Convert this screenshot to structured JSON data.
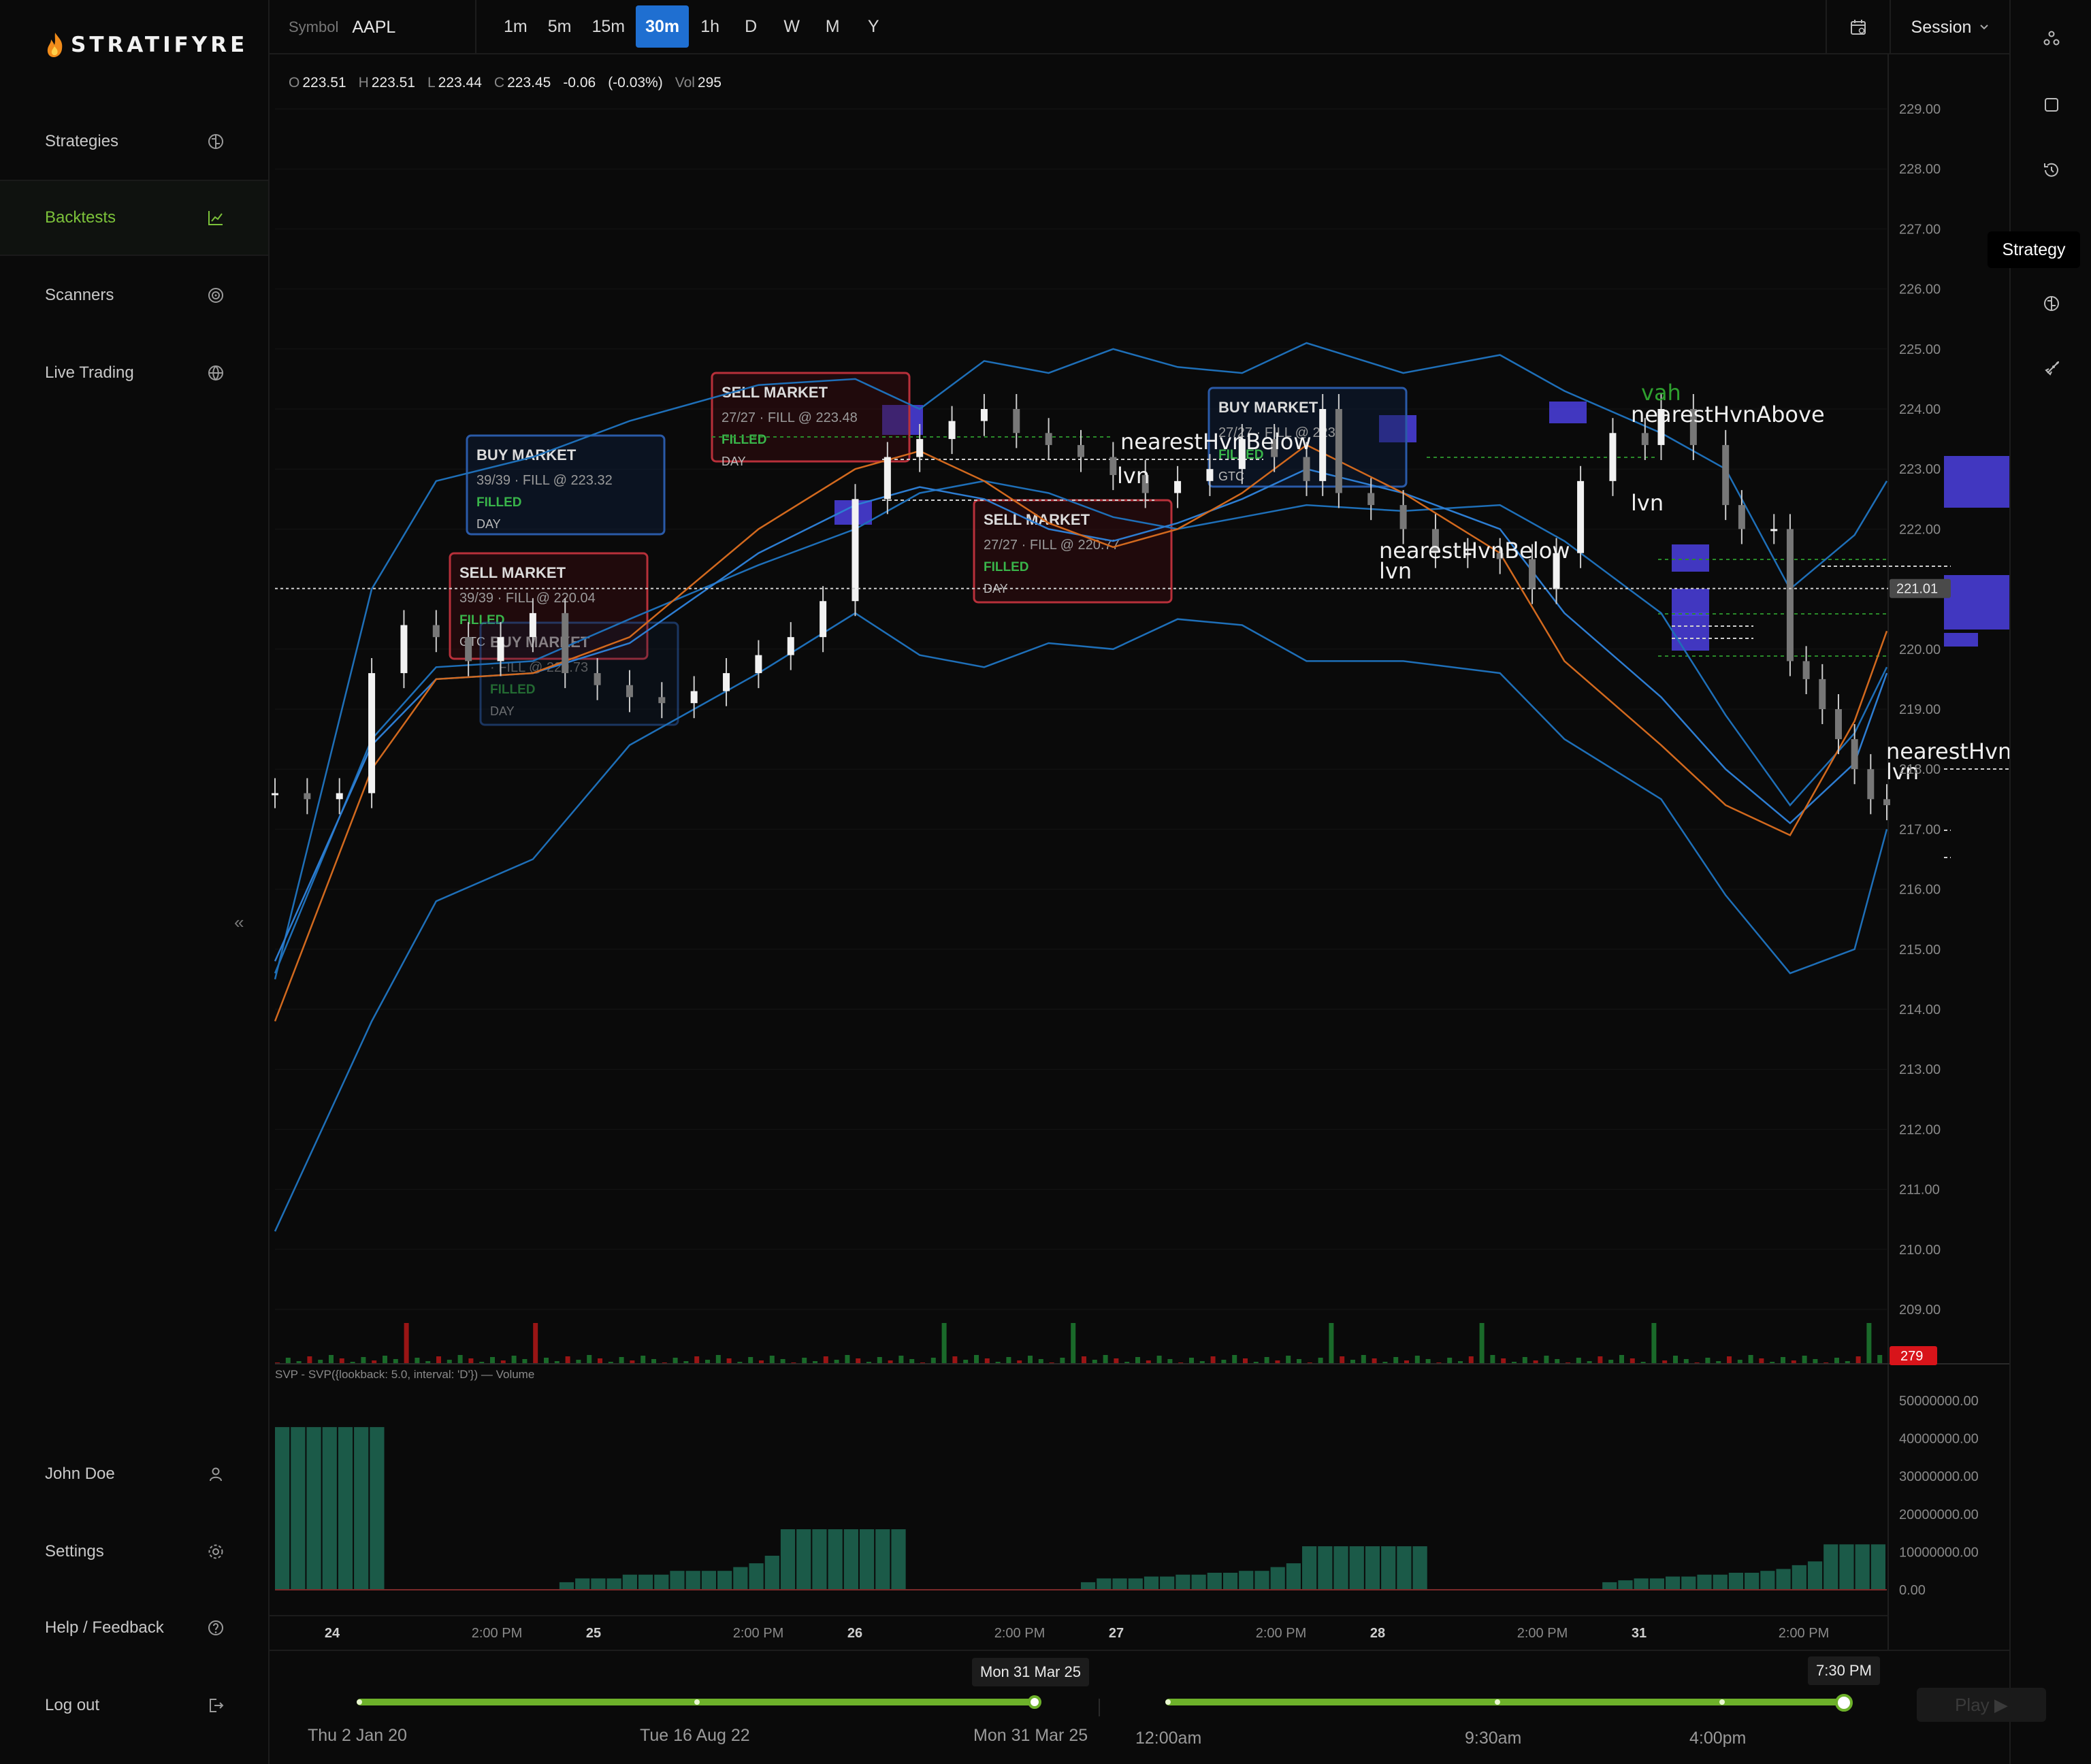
{
  "sidebar": {
    "logo_text": "STRATIFYRE",
    "nav": [
      {
        "label": "Strategies",
        "icon": "brain-icon",
        "active": false
      },
      {
        "label": "Backtests",
        "icon": "chart-bars-icon",
        "active": true
      },
      {
        "label": "Scanners",
        "icon": "radar-icon",
        "active": false
      },
      {
        "label": "Live Trading",
        "icon": "globe-icon",
        "active": false
      }
    ],
    "bottom": [
      {
        "label": "John Doe",
        "icon": "user-icon"
      },
      {
        "label": "Settings",
        "icon": "gear-icon"
      },
      {
        "label": "Help / Feedback",
        "icon": "help-icon"
      },
      {
        "label": "Log out",
        "icon": "logout-icon"
      }
    ],
    "collapse_glyph": "«"
  },
  "topbar": {
    "symbol_label": "Symbol",
    "symbol_value": "AAPL",
    "intervals": [
      "1m",
      "5m",
      "15m",
      "30m",
      "1h",
      "D",
      "W",
      "M",
      "Y"
    ],
    "active_interval": "30m",
    "session_label": "Session"
  },
  "rail": {
    "icons": [
      "nodes-icon",
      "square-icon",
      "history-icon",
      "brain-icon",
      "rocket-icon"
    ],
    "tooltip": "Strategy"
  },
  "ohlc": {
    "o_label": "O",
    "o": "223.51",
    "h_label": "H",
    "h": "223.51",
    "l_label": "L",
    "l": "223.44",
    "c_label": "C",
    "c": "223.45",
    "change": "-0.06",
    "change_pct": "(-0.03%)",
    "vol_label": "Vol",
    "vol": "295"
  },
  "chart_data": {
    "type": "candlestick",
    "symbol": "AAPL",
    "interval": "30m",
    "price_axis": [
      "229.00",
      "228.00",
      "227.00",
      "226.00",
      "225.00",
      "224.00",
      "223.00",
      "222.00",
      "221.00",
      "220.00",
      "219.00",
      "218.00",
      "217.00",
      "216.00",
      "215.00",
      "214.00",
      "213.00",
      "212.00",
      "211.00",
      "210.00",
      "209.00"
    ],
    "last_price": "221.01",
    "last_volume": "279",
    "ylim": [
      208.5,
      229.5
    ],
    "xlim": [
      0,
      100
    ],
    "closes": [
      [
        0,
        217.6
      ],
      [
        2,
        217.5
      ],
      [
        4,
        217.6
      ],
      [
        6,
        219.6
      ],
      [
        8,
        220.4
      ],
      [
        10,
        220.2
      ],
      [
        12,
        219.8
      ],
      [
        14,
        220.2
      ],
      [
        16,
        220.6
      ],
      [
        18,
        219.6
      ],
      [
        20,
        219.4
      ],
      [
        22,
        219.2
      ],
      [
        24,
        219.1
      ],
      [
        26,
        219.3
      ],
      [
        28,
        219.6
      ],
      [
        30,
        219.9
      ],
      [
        32,
        220.2
      ],
      [
        34,
        220.8
      ],
      [
        36,
        222.5
      ],
      [
        38,
        223.2
      ],
      [
        40,
        223.5
      ],
      [
        42,
        223.8
      ],
      [
        44,
        224.0
      ],
      [
        46,
        223.6
      ],
      [
        48,
        223.4
      ],
      [
        50,
        223.2
      ],
      [
        52,
        222.9
      ],
      [
        54,
        222.6
      ],
      [
        56,
        222.8
      ],
      [
        58,
        223.0
      ],
      [
        60,
        223.5
      ],
      [
        62,
        223.2
      ],
      [
        64,
        222.8
      ],
      [
        65,
        224.0
      ],
      [
        66,
        222.6
      ],
      [
        68,
        222.4
      ],
      [
        70,
        222.0
      ],
      [
        72,
        221.6
      ],
      [
        74,
        221.6
      ],
      [
        76,
        221.5
      ],
      [
        78,
        221.0
      ],
      [
        79.5,
        221.6
      ],
      [
        81,
        222.8
      ],
      [
        83,
        223.6
      ],
      [
        85,
        223.4
      ],
      [
        86,
        224.0
      ],
      [
        88,
        223.4
      ],
      [
        90,
        222.4
      ],
      [
        91,
        222.0
      ],
      [
        93,
        222.0
      ],
      [
        94,
        219.8
      ],
      [
        95,
        219.5
      ],
      [
        96,
        219.0
      ],
      [
        97,
        218.5
      ],
      [
        98,
        218.0
      ],
      [
        99,
        217.5
      ],
      [
        100,
        217.4
      ]
    ],
    "bollinger_upper": [
      [
        0,
        214.5
      ],
      [
        6,
        221.0
      ],
      [
        10,
        222.8
      ],
      [
        16,
        223.2
      ],
      [
        22,
        223.8
      ],
      [
        30,
        224.4
      ],
      [
        36,
        224.5
      ],
      [
        40,
        224.0
      ],
      [
        44,
        224.8
      ],
      [
        48,
        224.6
      ],
      [
        52,
        225.0
      ],
      [
        56,
        224.7
      ],
      [
        60,
        224.6
      ],
      [
        64,
        225.1
      ],
      [
        70,
        224.6
      ],
      [
        76,
        224.9
      ],
      [
        80,
        224.3
      ],
      [
        86,
        223.6
      ],
      [
        90,
        223.0
      ],
      [
        94,
        221.0
      ],
      [
        98,
        221.9
      ],
      [
        100,
        222.8
      ]
    ],
    "bollinger_lower": [
      [
        0,
        210.3
      ],
      [
        6,
        213.8
      ],
      [
        10,
        215.8
      ],
      [
        16,
        216.5
      ],
      [
        22,
        218.4
      ],
      [
        30,
        219.6
      ],
      [
        36,
        220.6
      ],
      [
        40,
        219.9
      ],
      [
        44,
        219.7
      ],
      [
        48,
        220.1
      ],
      [
        52,
        220.0
      ],
      [
        56,
        220.5
      ],
      [
        60,
        220.4
      ],
      [
        64,
        219.8
      ],
      [
        70,
        219.8
      ],
      [
        76,
        219.6
      ],
      [
        80,
        218.5
      ],
      [
        86,
        217.5
      ],
      [
        90,
        215.9
      ],
      [
        94,
        214.6
      ],
      [
        98,
        215.0
      ],
      [
        100,
        217.0
      ]
    ],
    "bollinger_mid": [
      [
        0,
        214.6
      ],
      [
        6,
        218.5
      ],
      [
        10,
        219.7
      ],
      [
        16,
        219.8
      ],
      [
        22,
        220.5
      ],
      [
        30,
        221.4
      ],
      [
        36,
        222.0
      ],
      [
        40,
        222.6
      ],
      [
        44,
        222.8
      ],
      [
        48,
        222.6
      ],
      [
        52,
        222.2
      ],
      [
        56,
        222.0
      ],
      [
        60,
        222.2
      ],
      [
        64,
        222.4
      ],
      [
        70,
        222.3
      ],
      [
        76,
        222.4
      ],
      [
        80,
        221.8
      ],
      [
        86,
        220.6
      ],
      [
        90,
        218.9
      ],
      [
        94,
        217.4
      ],
      [
        98,
        218.6
      ],
      [
        100,
        219.7
      ]
    ],
    "ema": [
      [
        0,
        213.8
      ],
      [
        6,
        218.0
      ],
      [
        10,
        219.5
      ],
      [
        16,
        219.6
      ],
      [
        22,
        220.2
      ],
      [
        30,
        222.0
      ],
      [
        36,
        223.0
      ],
      [
        40,
        223.3
      ],
      [
        44,
        222.8
      ],
      [
        48,
        222.1
      ],
      [
        52,
        221.7
      ],
      [
        56,
        222.0
      ],
      [
        60,
        222.6
      ],
      [
        64,
        223.4
      ],
      [
        70,
        222.6
      ],
      [
        76,
        221.6
      ],
      [
        80,
        219.8
      ],
      [
        86,
        218.4
      ],
      [
        90,
        217.4
      ],
      [
        94,
        216.9
      ],
      [
        98,
        218.8
      ],
      [
        100,
        220.3
      ]
    ],
    "sma": [
      [
        0,
        214.8
      ],
      [
        6,
        218.4
      ],
      [
        10,
        219.5
      ],
      [
        16,
        219.6
      ],
      [
        22,
        220.1
      ],
      [
        30,
        221.6
      ],
      [
        36,
        222.4
      ],
      [
        40,
        222.7
      ],
      [
        44,
        222.5
      ],
      [
        48,
        222.0
      ],
      [
        52,
        221.8
      ],
      [
        56,
        222.1
      ],
      [
        60,
        222.5
      ],
      [
        64,
        223.0
      ],
      [
        70,
        222.6
      ],
      [
        76,
        222.0
      ],
      [
        80,
        220.6
      ],
      [
        86,
        219.2
      ],
      [
        90,
        218.0
      ],
      [
        94,
        217.1
      ],
      [
        98,
        218.1
      ],
      [
        100,
        219.6
      ]
    ],
    "orders": [
      {
        "title": "BUY MARKET",
        "detail": "39/39 · FILL @ 223.32",
        "status": "FILLED",
        "tif": "DAY",
        "kind": "buy"
      },
      {
        "title": "SELL MARKET",
        "detail": "39/39 · FILL @ 220.04",
        "status": "FILLED",
        "tif": "GTC",
        "kind": "sell"
      },
      {
        "title": "BUY MARKET",
        "detail": "· FILL @ 220.73",
        "status": "FILLED",
        "tif": "DAY",
        "kind": "buy-faded"
      },
      {
        "title": "SELL MARKET",
        "detail": "27/27 · FILL @ 223.48",
        "status": "FILLED",
        "tif": "DAY",
        "kind": "sell"
      },
      {
        "title": "SELL MARKET",
        "detail": "27/27 · FILL @ 220.77",
        "status": "FILLED",
        "tif": "DAY",
        "kind": "sell"
      },
      {
        "title": "BUY MARKET",
        "detail": "27/27 · FILL @ 223.",
        "status": "FILLED",
        "tif": "GTC",
        "kind": "buy"
      }
    ],
    "annotations": [
      "nearestHvnBelow",
      "lvn",
      "nearestHvnAbove",
      "vah"
    ],
    "svp_title": "SVP - SVP({lookback: 5.0, interval: 'D'}) — Volume",
    "svp_axis": [
      "50000000.00",
      "40000000.00",
      "30000000.00",
      "20000000.00",
      "10000000.00",
      "0.00"
    ],
    "svp_ylim": [
      0,
      50000000
    ],
    "svp_bars": [
      43000000,
      43000000,
      43000000,
      43000000,
      43000000,
      43000000,
      43000000,
      0,
      0,
      0,
      0,
      0,
      0,
      0,
      0,
      0,
      0,
      0,
      2000000,
      3000000,
      3000000,
      3000000,
      4000000,
      4000000,
      4000000,
      5000000,
      5000000,
      5000000,
      5000000,
      6000000,
      7000000,
      9000000,
      16000000,
      16000000,
      16000000,
      16000000,
      16000000,
      16000000,
      16000000,
      16000000,
      0,
      0,
      0,
      0,
      0,
      0,
      0,
      0,
      0,
      0,
      0,
      2000000,
      3000000,
      3000000,
      3000000,
      3500000,
      3500000,
      4000000,
      4000000,
      4500000,
      4500000,
      5000000,
      5000000,
      6000000,
      7000000,
      11500000,
      11500000,
      11500000,
      11500000,
      11500000,
      11500000,
      11500000,
      11500000,
      0,
      0,
      0,
      0,
      0,
      0,
      0,
      0,
      0,
      0,
      0,
      2000000,
      2500000,
      3000000,
      3000000,
      3500000,
      3500000,
      4000000,
      4000000,
      4500000,
      4500000,
      5000000,
      5500000,
      6500000,
      7500000,
      12000000,
      12000000,
      12000000,
      12000000
    ],
    "x_ticks": [
      "24",
      "2:00 PM",
      "25",
      "2:00 PM",
      "26",
      "2:00 PM",
      "27",
      "2:00 PM",
      "28",
      "2:00 PM",
      "31",
      "2:00 PM"
    ]
  },
  "timeline": {
    "range_start": "Thu 2 Jan 20",
    "range_mid": "Tue 16 Aug 22",
    "range_end": "Mon 31 Mar 25",
    "range_tip": "Mon 31 Mar 25",
    "day_start": "12:00am",
    "day_mid": "9:30am",
    "day_late": "4:00pm",
    "day_tip": "7:30 PM",
    "play_label": "Play ▶"
  },
  "colors": {
    "accent": "#1f6fd1",
    "green": "#6db12a",
    "bb": "#1e6fb8",
    "ema": "#d2691e",
    "profile": "#4b3fe0"
  }
}
